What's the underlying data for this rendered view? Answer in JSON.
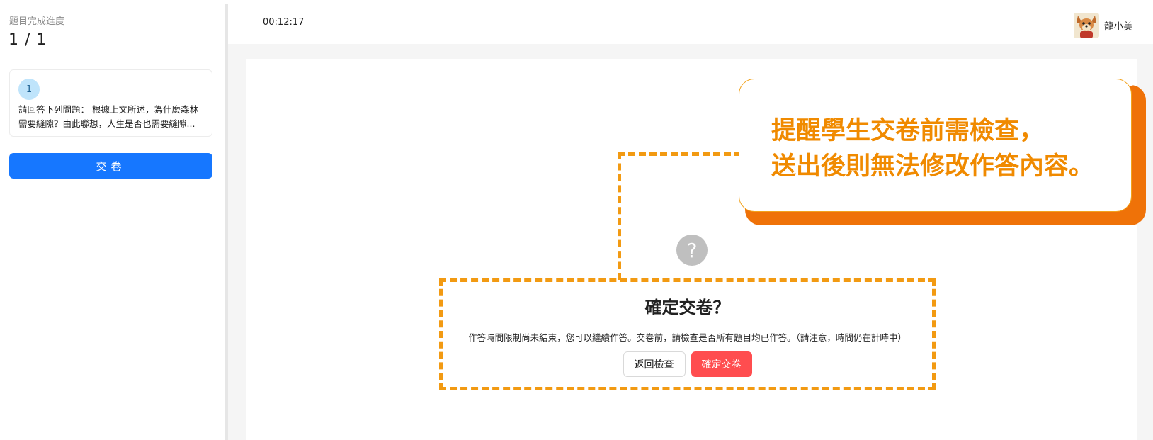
{
  "sidebar": {
    "progress_label": "題目完成進度",
    "progress_value": "1 / 1",
    "question": {
      "number": "1",
      "text": "請回答下列問題： 根據上文所述，為什麼森林需要縫隙？由此聯想，人生是否也需要縫隙..."
    },
    "submit_label": "交卷"
  },
  "header": {
    "timer": "00:12:17",
    "username": "龍小美"
  },
  "dialog": {
    "icon": "question-circle-icon",
    "title": "確定交卷？",
    "description": "作答時間限制尚未結束，您可以繼續作答。交卷前，請檢查是否所有題目均已作答。（請注意，時間仍在計時中）",
    "back_label": "返回檢查",
    "confirm_label": "確定交卷"
  },
  "callout": {
    "line1": "提醒學生交卷前需檢查，",
    "line2": "送出後則無法修改作答內容。"
  },
  "colors": {
    "primary": "#1677ff",
    "danger": "#ff4d4f",
    "annotation_orange": "#f29a12",
    "callout_shadow": "#ef7208"
  }
}
